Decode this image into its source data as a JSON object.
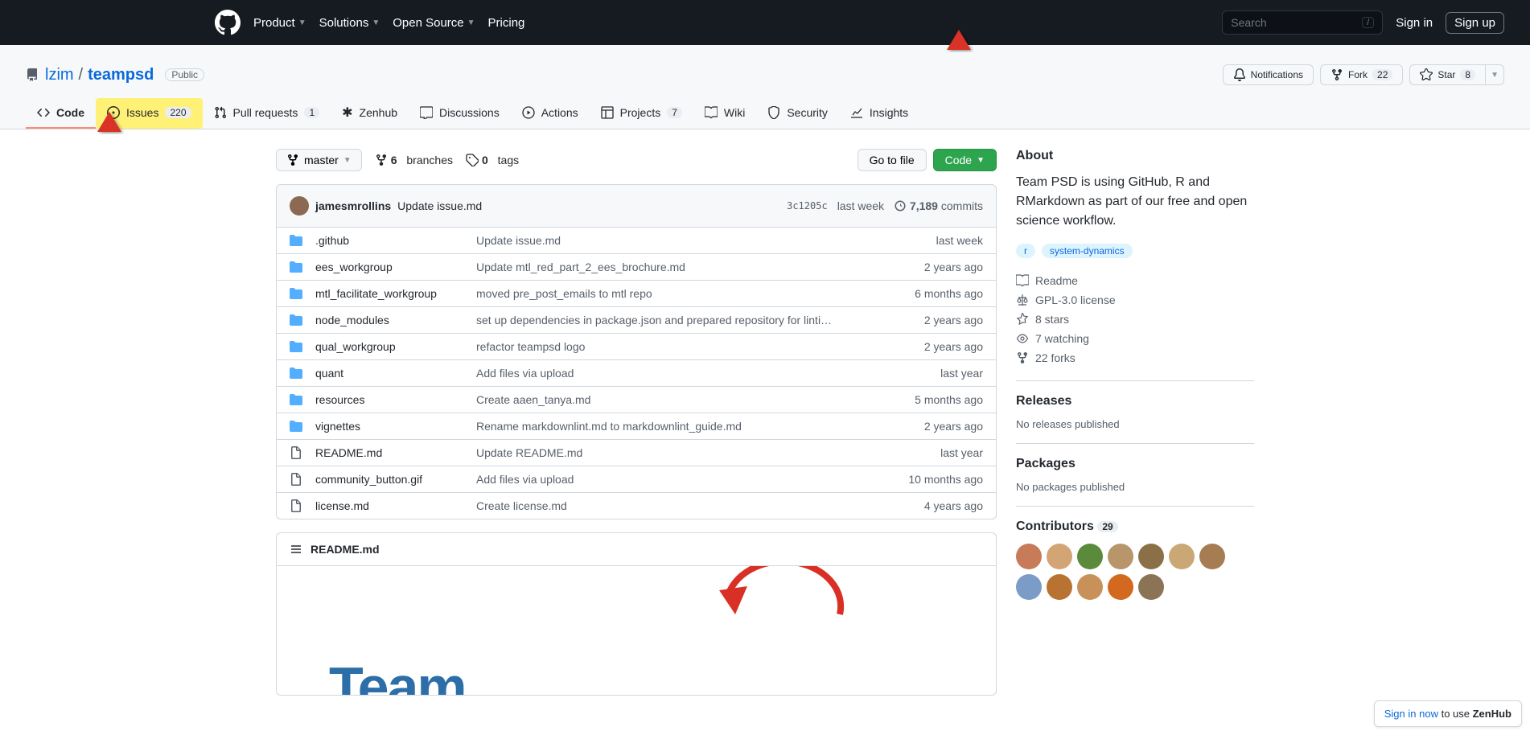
{
  "header": {
    "nav": [
      "Product",
      "Solutions",
      "Open Source",
      "Pricing"
    ],
    "search_placeholder": "Search",
    "slash": "/",
    "signin": "Sign in",
    "signup": "Sign up"
  },
  "repo": {
    "owner": "lzim",
    "name": "teampsd",
    "visibility": "Public"
  },
  "actions": {
    "notifications": "Notifications",
    "fork": "Fork",
    "fork_count": "22",
    "star": "Star",
    "star_count": "8"
  },
  "tabs": {
    "code": "Code",
    "issues": "Issues",
    "issues_count": "220",
    "pulls": "Pull requests",
    "pulls_count": "1",
    "zenhub": "Zenhub",
    "discussions": "Discussions",
    "actions": "Actions",
    "projects": "Projects",
    "projects_count": "7",
    "wiki": "Wiki",
    "security": "Security",
    "insights": "Insights"
  },
  "fileNav": {
    "branch": "master",
    "branches_count": "6",
    "branches_label": "branches",
    "tags_count": "0",
    "tags_label": "tags",
    "goToFile": "Go to file",
    "code": "Code"
  },
  "latestCommit": {
    "author": "jamesmrollins",
    "message": "Update issue.md",
    "sha": "3c1205c",
    "when": "last week",
    "commits_count": "7,189",
    "commits_label": "commits"
  },
  "files": [
    {
      "type": "dir",
      "name": ".github",
      "msg": "Update issue.md",
      "age": "last week"
    },
    {
      "type": "dir",
      "name": "ees_workgroup",
      "msg": "Update mtl_red_part_2_ees_brochure.md",
      "age": "2 years ago"
    },
    {
      "type": "dir",
      "name": "mtl_facilitate_workgroup",
      "msg": "moved pre_post_emails to mtl repo",
      "age": "6 months ago"
    },
    {
      "type": "dir",
      "name": "node_modules",
      "msg": "set up dependencies in package.json and prepared repository for linti…",
      "age": "2 years ago"
    },
    {
      "type": "dir",
      "name": "qual_workgroup",
      "msg": "refactor teampsd logo",
      "age": "2 years ago"
    },
    {
      "type": "dir",
      "name": "quant",
      "msg": "Add files via upload",
      "age": "last year"
    },
    {
      "type": "dir",
      "name": "resources",
      "msg": "Create aaen_tanya.md",
      "age": "5 months ago"
    },
    {
      "type": "dir",
      "name": "vignettes",
      "msg": "Rename markdownlint.md to markdownlint_guide.md",
      "age": "2 years ago"
    },
    {
      "type": "file",
      "name": "README.md",
      "msg": "Update README.md",
      "age": "last year"
    },
    {
      "type": "file",
      "name": "community_button.gif",
      "msg": "Add files via upload",
      "age": "10 months ago"
    },
    {
      "type": "file",
      "name": "license.md",
      "msg": "Create license.md",
      "age": "4 years ago"
    }
  ],
  "readme": {
    "filename": "README.md",
    "team_text": "Team"
  },
  "about": {
    "title": "About",
    "description": "Team PSD is using GitHub, R and RMarkdown as part of our free and open science workflow.",
    "topics": [
      "r",
      "system-dynamics"
    ],
    "readme": "Readme",
    "license": "GPL-3.0 license",
    "stars": "8 stars",
    "watching": "7 watching",
    "forks": "22 forks"
  },
  "releases": {
    "title": "Releases",
    "none": "No releases published"
  },
  "packages": {
    "title": "Packages",
    "none": "No packages published"
  },
  "contributors": {
    "title": "Contributors",
    "count": "29",
    "avatars": [
      "#c77b58",
      "#d4a574",
      "#5a8a3a",
      "#b8956b",
      "#8b6f47",
      "#c9a876",
      "#a67c52",
      "#7a9cc6",
      "#b87333",
      "#c9915a",
      "#d2691e",
      "#8b7355"
    ]
  },
  "zenhub": {
    "signin": "Sign in now",
    "rest": " to use ",
    "product": "ZenHub"
  }
}
